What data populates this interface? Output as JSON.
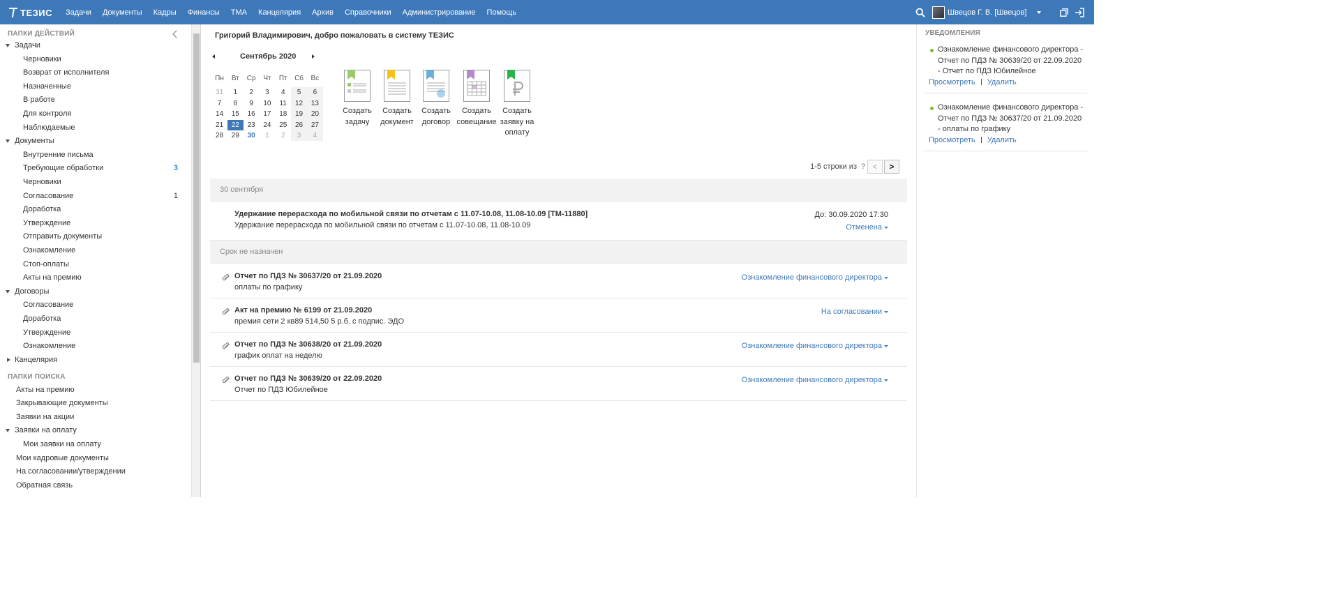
{
  "header": {
    "logo_text": "ТЕЗИС",
    "menu": [
      "Задачи",
      "Документы",
      "Кадры",
      "Финансы",
      "ТМА",
      "Канцелярия",
      "Архив",
      "Справочники",
      "Администрирование",
      "Помощь"
    ],
    "user": "Швецов Г. В. [Швецов]",
    "accent_color": "#3d78b9"
  },
  "left_panel": {
    "section_actions": "ПАПКИ ДЕЙСТВИЙ",
    "section_search": "ПАПКИ ПОИСКА",
    "items": [
      {
        "label": "Задачи",
        "level": 0,
        "expanded": true,
        "count": ""
      },
      {
        "label": "Черновики",
        "level": 1,
        "count": ""
      },
      {
        "label": "Возврат от исполнителя",
        "level": 1,
        "count": ""
      },
      {
        "label": "Назначенные",
        "level": 1,
        "count": ""
      },
      {
        "label": "В работе",
        "level": 1,
        "count": ""
      },
      {
        "label": "Для контроля",
        "level": 1,
        "count": ""
      },
      {
        "label": "Наблюдаемые",
        "level": 1,
        "count": ""
      },
      {
        "label": "Документы",
        "level": 0,
        "expanded": true,
        "count": ""
      },
      {
        "label": "Внутренние письма",
        "level": 1,
        "count": ""
      },
      {
        "label": "Требующие обработки",
        "level": 1,
        "count": "3",
        "count_highlight": true
      },
      {
        "label": "Черновики",
        "level": 1,
        "count": ""
      },
      {
        "label": "Согласование",
        "level": 1,
        "count": "1"
      },
      {
        "label": "Доработка",
        "level": 1,
        "count": ""
      },
      {
        "label": "Утверждение",
        "level": 1,
        "count": ""
      },
      {
        "label": "Отправить документы",
        "level": 1,
        "count": ""
      },
      {
        "label": "Ознакомление",
        "level": 1,
        "count": ""
      },
      {
        "label": "Стоп-оплаты",
        "level": 1,
        "count": ""
      },
      {
        "label": "Акты на премию",
        "level": 1,
        "count": ""
      },
      {
        "label": "Договоры",
        "level": 0,
        "expanded": true,
        "count": ""
      },
      {
        "label": "Согласование",
        "level": 1,
        "count": ""
      },
      {
        "label": "Доработка",
        "level": 1,
        "count": ""
      },
      {
        "label": "Утверждение",
        "level": 1,
        "count": ""
      },
      {
        "label": "Ознакомление",
        "level": 1,
        "count": ""
      },
      {
        "label": "Канцелярия",
        "level": 0,
        "expanded": false,
        "count": ""
      }
    ],
    "search_items": [
      {
        "label": "Акты на премию",
        "level": 0,
        "leaf": true
      },
      {
        "label": "Закрывающие документы",
        "level": 0,
        "leaf": true
      },
      {
        "label": "Заявки на акции",
        "level": 0,
        "leaf": true
      },
      {
        "label": "Заявки на оплату",
        "level": 0,
        "expanded": true
      },
      {
        "label": "Мои заявки на оплату",
        "level": 1
      },
      {
        "label": "Мои кадровые документы",
        "level": 0,
        "leaf": true
      },
      {
        "label": "На согласовании/утверждении",
        "level": 0,
        "leaf": true
      },
      {
        "label": "Обратная связь",
        "level": 0,
        "leaf": true
      }
    ]
  },
  "main": {
    "welcome": "Григорий Владимирович, добро пожаловать в систему ТЕЗИС",
    "calendar": {
      "month_title": "Сентябрь 2020",
      "weekdays": [
        "Пн",
        "Вт",
        "Ср",
        "Чт",
        "Пт",
        "Сб",
        "Вс"
      ],
      "weeks": [
        [
          "31",
          "1",
          "2",
          "3",
          "4",
          "5",
          "6"
        ],
        [
          "7",
          "8",
          "9",
          "10",
          "11",
          "12",
          "13"
        ],
        [
          "14",
          "15",
          "16",
          "17",
          "18",
          "19",
          "20"
        ],
        [
          "21",
          "22",
          "23",
          "24",
          "25",
          "26",
          "27"
        ],
        [
          "28",
          "29",
          "30",
          "1",
          "2",
          "3",
          "4"
        ]
      ],
      "selected_day": "22",
      "highlighted_day": "30"
    },
    "create_actions": [
      {
        "label": "Создать задачу",
        "icon": "create-task-icon",
        "color": "#9cc96b"
      },
      {
        "label": "Создать документ",
        "icon": "create-document-icon",
        "color": "#f2c21b"
      },
      {
        "label": "Создать договор",
        "icon": "create-contract-icon",
        "color": "#6ab0d8"
      },
      {
        "label": "Создать совещание",
        "icon": "create-meeting-icon",
        "color": "#b58acb"
      },
      {
        "label": "Создать заявку на оплату",
        "icon": "create-payment-request-icon",
        "color": "#2bb24c"
      }
    ],
    "pager": {
      "text": "1-5 строки из",
      "help": "?",
      "prev": "<",
      "next": ">"
    },
    "groups": [
      {
        "title": "30 сентября",
        "tasks": [
          {
            "title": "Удержание перерасхода по мобильной связи по отчетам с 11.07-10.08, 11.08-10.09 [TM-11880]",
            "subtitle": "Удержание перерасхода по мобильной связи по отчетам с 11.07-10.08, 11.08-10.09",
            "due": "До: 30.09.2020 17:30",
            "status": "Отменена",
            "attachment": false
          }
        ]
      },
      {
        "title": "Срок не назначен",
        "tasks": [
          {
            "title": "Отчет по ПДЗ № 30637/20 от 21.09.2020",
            "subtitle": "оплаты по графику",
            "due": "",
            "status": "Ознакомление финансового директора",
            "attachment": true
          },
          {
            "title": "Акт на премию № 6199 от 21.09.2020",
            "subtitle": "премия сети 2 кв89 514,50 5 р.б. с подпис. ЭДО",
            "due": "",
            "status": "На согласовании",
            "attachment": true
          },
          {
            "title": "Отчет по ПДЗ № 30638/20 от 21.09.2020",
            "subtitle": "график оплат на неделю",
            "due": "",
            "status": "Ознакомление финансового директора",
            "attachment": true
          },
          {
            "title": "Отчет по ПДЗ № 30639/20 от 22.09.2020",
            "subtitle": "Отчет по ПДЗ Юбилейное",
            "due": "",
            "status": "Ознакомление финансового директора",
            "attachment": true
          }
        ]
      }
    ]
  },
  "notifications": {
    "title": "УВЕДОМЛЕНИЯ",
    "items": [
      {
        "text": "Ознакомление финансового директора - Отчет по ПДЗ № 30639/20 от 22.09.2020 - Отчет по ПДЗ Юбилейное",
        "view": "Просмотреть",
        "delete": "Удалить"
      },
      {
        "text": "Ознакомление финансового директора - Отчет по ПДЗ № 30637/20 от 21.09.2020 - оплаты по графику",
        "view": "Просмотреть",
        "delete": "Удалить"
      }
    ],
    "status_color": "#7bb73a"
  }
}
